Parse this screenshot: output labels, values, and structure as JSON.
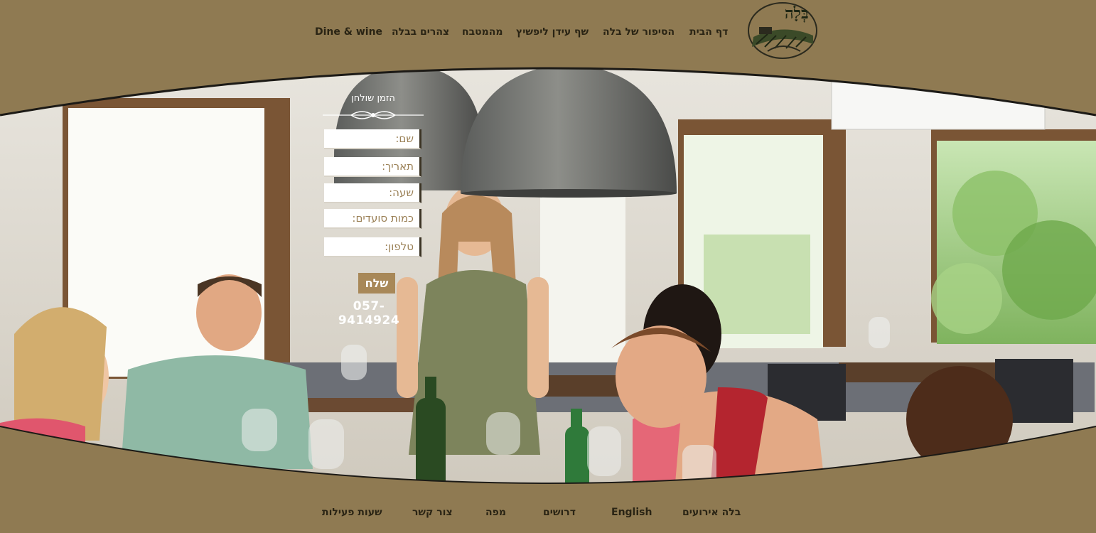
{
  "top_nav": {
    "home": "דף הבית",
    "story": "הסיפור של בלה",
    "chef": "שף עידן ליפשיץ",
    "kitchen": "מהמטבח",
    "lunch": "צהרים בבלה",
    "dine_wine": "Dine & wine"
  },
  "logo": {
    "icon": "vineyard-logo",
    "text": "בְּלָה"
  },
  "reservation": {
    "title": "הזמן שולחן",
    "fields": {
      "name": "שם:",
      "date": "תאריך:",
      "time": "שעה:",
      "guests": "כמות סועדים:",
      "phone": "טלפון:"
    },
    "submit_label": "שלח",
    "phone_number": "057-9414924"
  },
  "bottom_nav": {
    "events": "בלה אירועים",
    "english": "English",
    "jobs": "דרושים",
    "map": "מפה",
    "contact": "צור קשר",
    "hours": "שעות פעילות"
  },
  "colors": {
    "frame": "#8f7a52",
    "nav_text": "#2a2414",
    "button": "#a88858",
    "field_label": "#9b8157"
  }
}
